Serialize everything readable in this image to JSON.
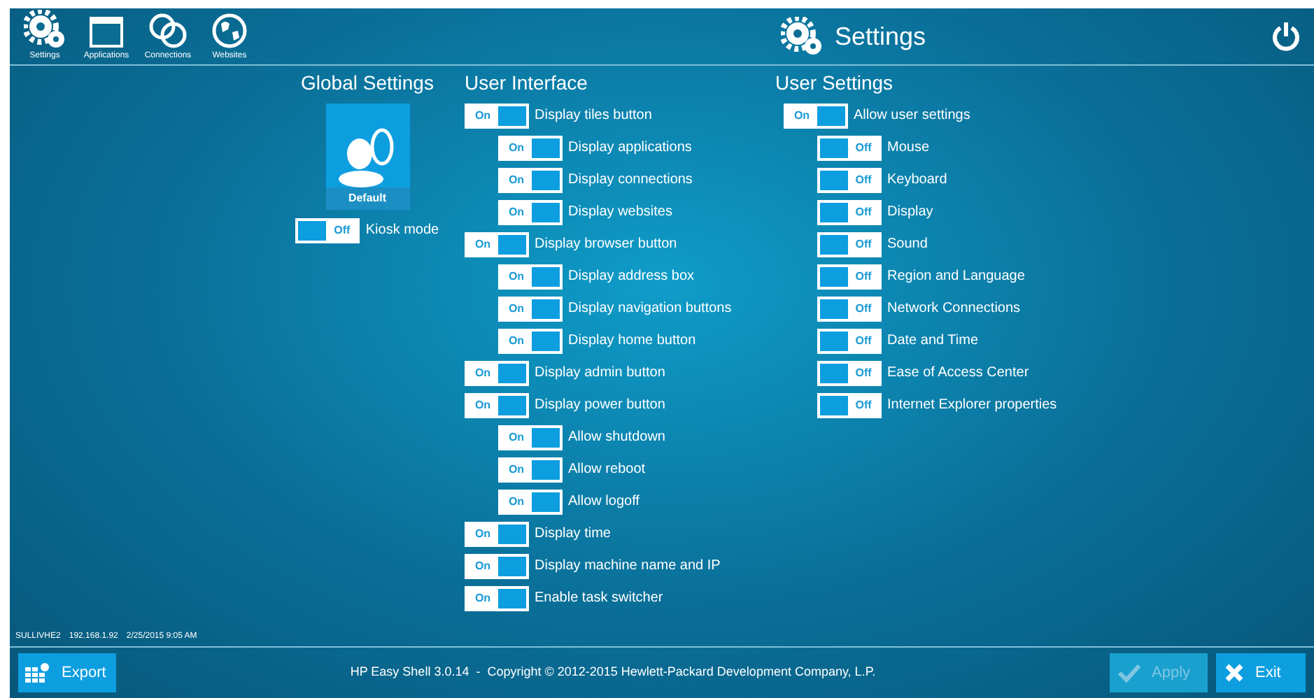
{
  "nav": [
    {
      "label": "Settings",
      "kind": "gears"
    },
    {
      "label": "Applications",
      "kind": "window"
    },
    {
      "label": "Connections",
      "kind": "rings"
    },
    {
      "label": "Websites",
      "kind": "globe"
    }
  ],
  "title": "Settings",
  "global_settings": {
    "heading": "Global Settings",
    "profile": "Default",
    "toggle": {
      "label": "Kiosk mode",
      "on": false,
      "state_text": "Off"
    }
  },
  "user_interface": {
    "heading": "User Interface",
    "items": [
      {
        "label": "Display tiles button",
        "on": true,
        "state_text": "On",
        "children": [
          {
            "label": "Display applications",
            "on": true,
            "state_text": "On"
          },
          {
            "label": "Display connections",
            "on": true,
            "state_text": "On"
          },
          {
            "label": "Display websites",
            "on": true,
            "state_text": "On"
          }
        ]
      },
      {
        "label": "Display browser button",
        "on": true,
        "state_text": "On",
        "children": [
          {
            "label": "Display address box",
            "on": true,
            "state_text": "On"
          },
          {
            "label": "Display navigation buttons",
            "on": true,
            "state_text": "On"
          },
          {
            "label": "Display home button",
            "on": true,
            "state_text": "On"
          }
        ]
      },
      {
        "label": "Display admin button",
        "on": true,
        "state_text": "On"
      },
      {
        "label": "Display power button",
        "on": true,
        "state_text": "On",
        "children": [
          {
            "label": "Allow shutdown",
            "on": true,
            "state_text": "On"
          },
          {
            "label": "Allow reboot",
            "on": true,
            "state_text": "On"
          },
          {
            "label": "Allow logoff",
            "on": true,
            "state_text": "On"
          }
        ]
      },
      {
        "label": "Display time",
        "on": true,
        "state_text": "On"
      },
      {
        "label": "Display machine name and IP",
        "on": true,
        "state_text": "On"
      },
      {
        "label": "Enable task switcher",
        "on": true,
        "state_text": "On"
      }
    ]
  },
  "user_settings": {
    "heading": "User Settings",
    "items": [
      {
        "label": "Allow user settings",
        "on": true,
        "state_text": "On",
        "children": [
          {
            "label": "Mouse",
            "on": false,
            "state_text": "Off"
          },
          {
            "label": "Keyboard",
            "on": false,
            "state_text": "Off"
          },
          {
            "label": "Display",
            "on": false,
            "state_text": "Off"
          },
          {
            "label": "Sound",
            "on": false,
            "state_text": "Off"
          },
          {
            "label": "Region and Language",
            "on": false,
            "state_text": "Off"
          },
          {
            "label": "Network Connections",
            "on": false,
            "state_text": "Off"
          },
          {
            "label": "Date and Time",
            "on": false,
            "state_text": "Off"
          },
          {
            "label": "Ease of Access Center",
            "on": false,
            "state_text": "Off"
          },
          {
            "label": "Internet Explorer properties",
            "on": false,
            "state_text": "Off"
          }
        ]
      }
    ]
  },
  "status": {
    "machine": "SULLIVHE2",
    "ip": "192.168.1.92",
    "time": "2/25/2015 9:05 AM"
  },
  "footer": {
    "export": "Export",
    "copyright": "HP Easy Shell 3.0.14  -  Copyright © 2012-2015 Hewlett-Packard Development Company, L.P.",
    "apply": {
      "label": "Apply",
      "disabled": true
    },
    "exit": "Exit"
  }
}
